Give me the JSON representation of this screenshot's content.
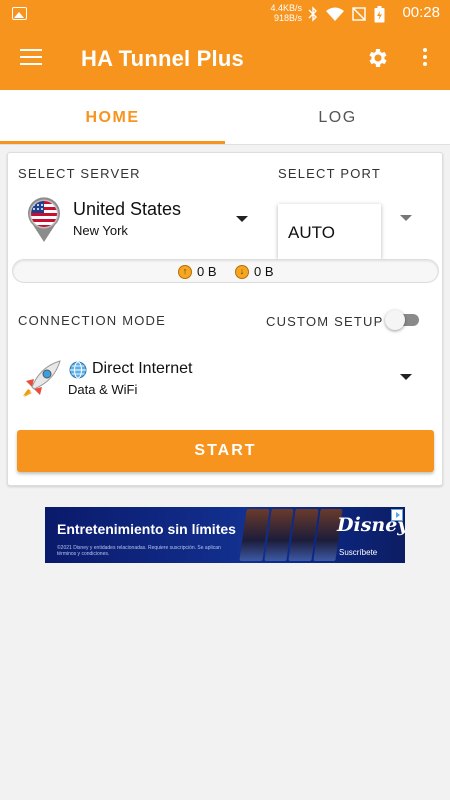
{
  "status_bar": {
    "net_up": "4.4KB/s",
    "net_down": "918B/s",
    "time": "00:28"
  },
  "app_bar": {
    "title": "HA Tunnel Plus"
  },
  "tabs": [
    {
      "label": "HOME",
      "selected": true
    },
    {
      "label": "LOG",
      "selected": false
    }
  ],
  "server": {
    "section_label": "SELECT SERVER",
    "country": "United States",
    "city": "New York"
  },
  "port": {
    "section_label": "SELECT PORT",
    "value": "AUTO"
  },
  "traffic": {
    "upload": "0 B",
    "download": "0 B"
  },
  "connection": {
    "section_label": "CONNECTION MODE",
    "custom_setup_label": "CUSTOM SETUP",
    "custom_setup_on": false,
    "mode": "Direct Internet",
    "mode_sub": "Data & WiFi"
  },
  "start_button": {
    "label": "START"
  },
  "ad": {
    "headline": "Entretenimiento sin límites",
    "fine_print": "©2021 Disney y entidades relacionadas. Requiere suscripción. Se aplican términos y condiciones.",
    "brand": "Disney+",
    "cta": "Suscríbete"
  },
  "colors": {
    "accent": "#f7941d",
    "background": "#f2f2f2"
  }
}
